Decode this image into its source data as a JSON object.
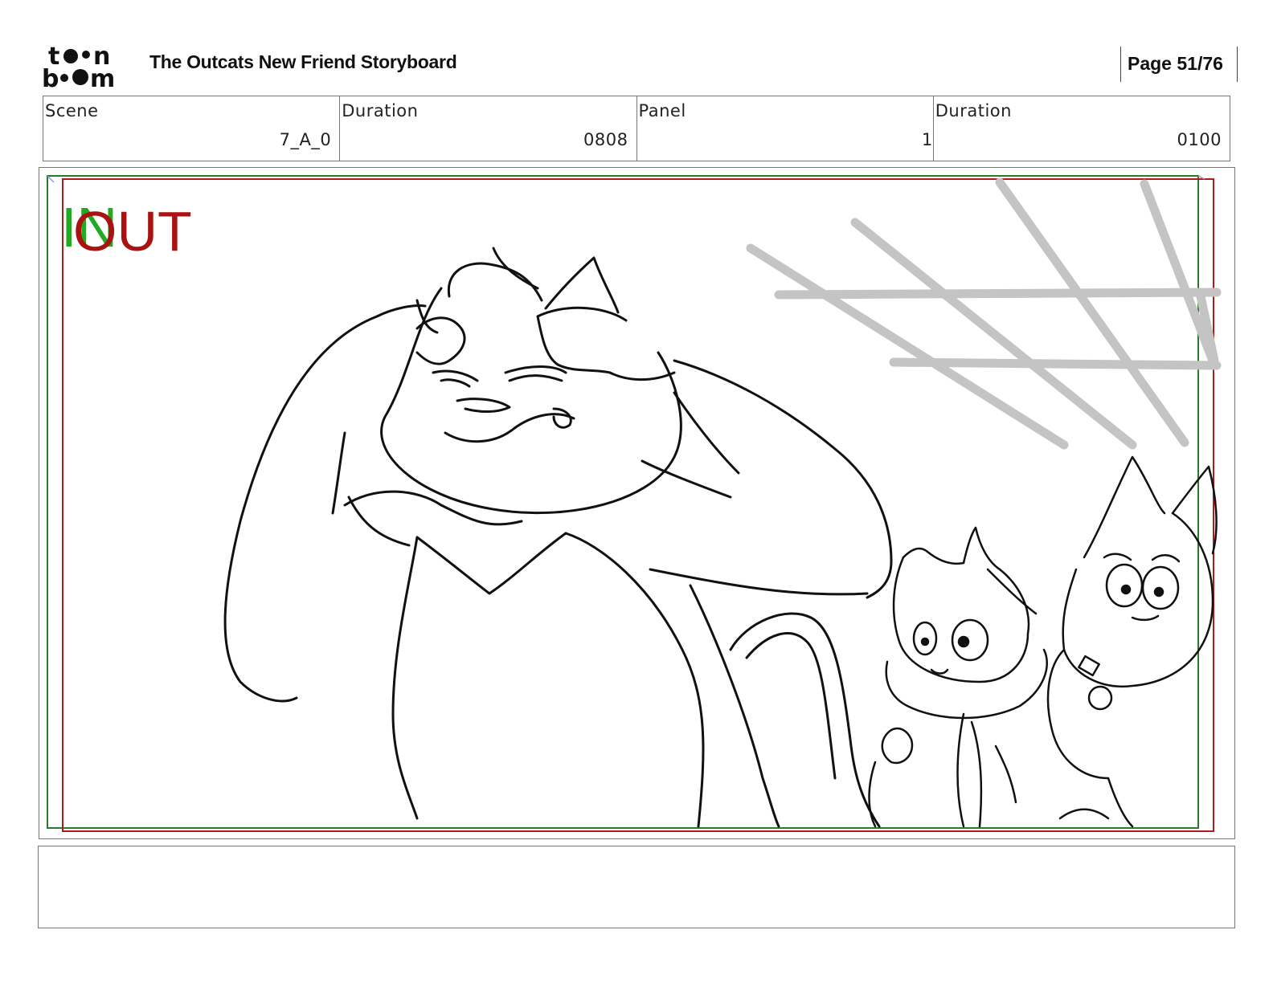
{
  "header": {
    "logo_text": "toonboom",
    "title": "The Outcats New Friend Storyboard",
    "page": "Page 51/76"
  },
  "info": {
    "scene_label": "Scene",
    "scene_value": "7_A_0",
    "scene_duration_label": "Duration",
    "scene_duration_value": "0808",
    "panel_label": "Panel",
    "panel_value": "1",
    "panel_duration_label": "Duration",
    "panel_duration_value": "0100"
  },
  "panel": {
    "in_label": "IN",
    "out_label": "OUT",
    "in_color": "#22aa22",
    "out_color": "#aa1111"
  },
  "caption": {
    "text": ""
  }
}
